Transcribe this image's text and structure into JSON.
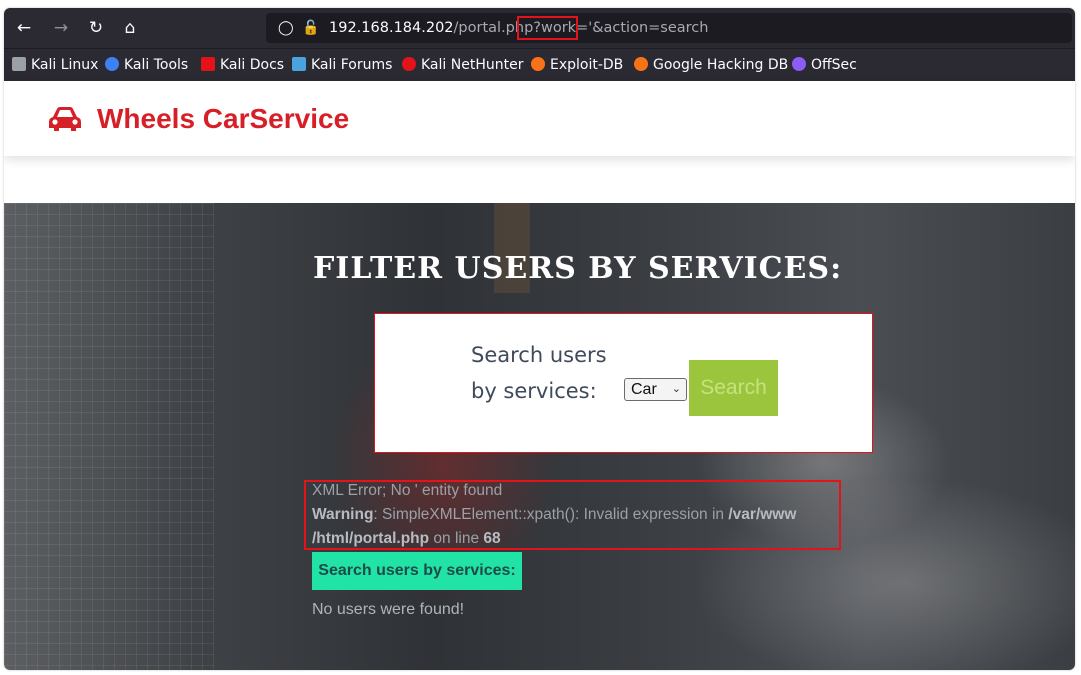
{
  "browser": {
    "url_host": "192.168.184.202",
    "url_path": "/portal.php",
    "url_query_highlight": "?work='",
    "url_query_rest": "&action=search",
    "nav": {
      "back_icon": "arrow-left-icon",
      "forward_icon": "arrow-right-icon",
      "reload_icon": "reload-icon",
      "home_icon": "home-icon"
    },
    "bookmarks": [
      {
        "label": "Kali Linux",
        "icon": "kali-dragon-icon",
        "color": "#9aa0a6"
      },
      {
        "label": "Kali Tools",
        "icon": "kali-tools-icon",
        "color": "#3b82f6"
      },
      {
        "label": "Kali Docs",
        "icon": "kali-docs-icon",
        "color": "#e3131b"
      },
      {
        "label": "Kali Forums",
        "icon": "kali-forums-icon",
        "color": "#4aa3df"
      },
      {
        "label": "Kali NetHunter",
        "icon": "kali-nethunter-icon",
        "color": "#e3131b"
      },
      {
        "label": "Exploit-DB",
        "icon": "exploit-db-icon",
        "color": "#f97316"
      },
      {
        "label": "Google Hacking DB",
        "icon": "ghdb-icon",
        "color": "#f97316"
      },
      {
        "label": "OffSec",
        "icon": "offsec-icon",
        "color": "#8b5cf6"
      }
    ]
  },
  "site": {
    "brand": "Wheels CarService",
    "brand_color": "#d71f27"
  },
  "hero": {
    "title": "FILTER USERS BY SERVICES:",
    "search_label_line1": "Search users",
    "search_label_line2": "by services:",
    "select_value": "Car",
    "search_button": "Search"
  },
  "results": {
    "error_line1": "XML Error; No ' entity found",
    "warning_label": "Warning",
    "warning_text": ": SimpleXMLElement::xpath(): Invalid expression in ",
    "warning_path": "/var/www",
    "warning_path2": "/html/portal.php",
    "warning_line_text": " on line ",
    "warning_line_no": "68",
    "result_button": "Search users by services:",
    "no_users": "No users were found!"
  }
}
